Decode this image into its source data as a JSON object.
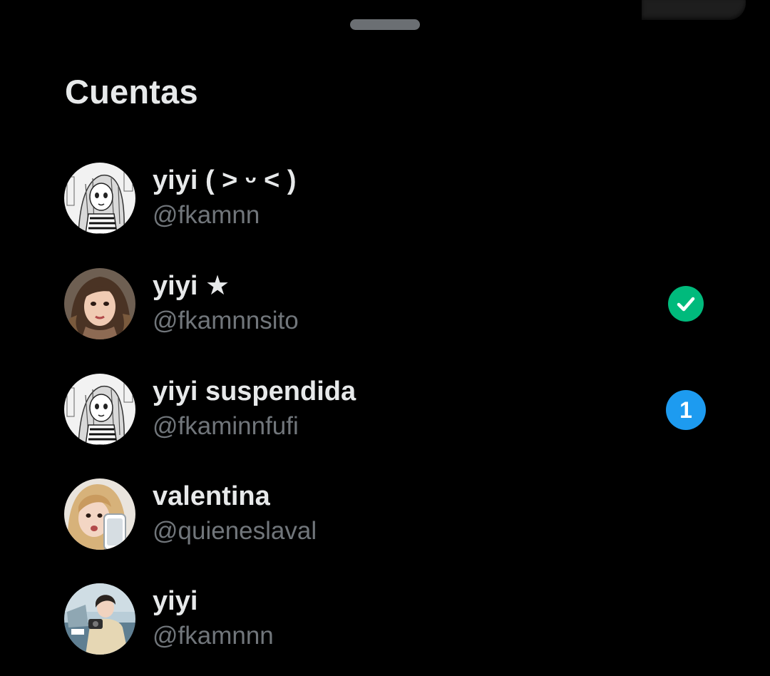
{
  "sheet": {
    "title": "Cuentas"
  },
  "accounts": [
    {
      "display_name": "yiyi ( ˃ ᵕ ˂ )",
      "username": "@fkamnn",
      "avatar": "manga-girl-avatar",
      "selected": false,
      "badge": ""
    },
    {
      "display_name": "yiyi ★",
      "username": "@fkamnnsito",
      "avatar": "girl-portrait-avatar",
      "selected": true,
      "badge": ""
    },
    {
      "display_name": "yiyi suspendida",
      "username": "@fkaminnfufi",
      "avatar": "manga-girl-avatar",
      "selected": false,
      "badge": "1"
    },
    {
      "display_name": "valentina",
      "username": "@quieneslaval",
      "avatar": "blonde-girl-avatar",
      "selected": false,
      "badge": ""
    },
    {
      "display_name": "yiyi",
      "username": "@fkamnnn",
      "avatar": "boy-with-camera-avatar",
      "selected": false,
      "badge": ""
    }
  ],
  "colors": {
    "background": "#000000",
    "primary_text": "#e7e9ea",
    "secondary_text": "#71767b",
    "selected_check": "#00ba7c",
    "notification_badge": "#1d9bf0",
    "drag_handle": "#6b6f73"
  },
  "icons": {
    "selected": "check-icon",
    "handle": "drag-handle"
  }
}
